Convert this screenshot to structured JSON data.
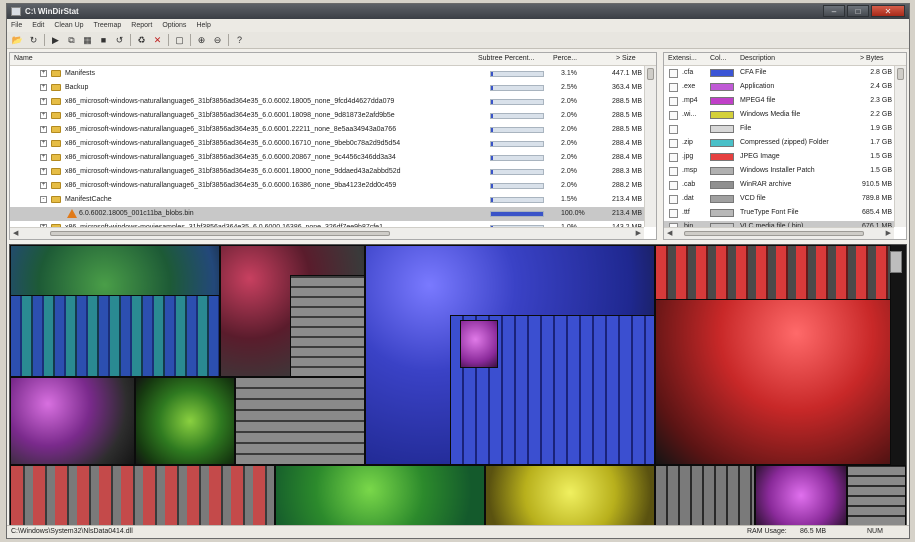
{
  "window": {
    "title": "C:\\ WinDirStat"
  },
  "menu": [
    "File",
    "Edit",
    "Clean Up",
    "Treemap",
    "Report",
    "Options",
    "Help"
  ],
  "toolbar_icons": [
    "open-icon",
    "refresh-icon",
    "play-icon",
    "copy-path-icon",
    "explorer-icon",
    "command-prompt-icon",
    "refresh-selected-icon",
    "recycle-icon",
    "delete-icon",
    "properties-icon",
    "zoom-in-icon",
    "zoom-out-icon",
    "help-icon"
  ],
  "tree": {
    "columns": {
      "name": "Name",
      "subtree": "Subtree Percent...",
      "percent": "Perce...",
      "size": "> Size"
    },
    "rows": [
      {
        "indent": 1,
        "type": "folder",
        "expand": "+",
        "name": "Manifests",
        "fill": 0.031,
        "percent": "3.1%",
        "size": "447.1 MB"
      },
      {
        "indent": 1,
        "type": "folder",
        "expand": "+",
        "name": "Backup",
        "fill": 0.025,
        "percent": "2.5%",
        "size": "363.4 MB"
      },
      {
        "indent": 1,
        "type": "folder",
        "expand": "+",
        "name": "x86_microsoft-windows-naturallanguage6_31bf3856ad364e35_6.0.6002.18005_none_9fcd4d4627dda079",
        "fill": 0.02,
        "percent": "2.0%",
        "size": "288.5 MB"
      },
      {
        "indent": 1,
        "type": "folder",
        "expand": "+",
        "name": "x86_microsoft-windows-naturallanguage6_31bf3856ad364e35_6.0.6001.18098_none_9d81873e2afd9b5e",
        "fill": 0.02,
        "percent": "2.0%",
        "size": "288.5 MB"
      },
      {
        "indent": 1,
        "type": "folder",
        "expand": "+",
        "name": "x86_microsoft-windows-naturallanguage6_31bf3856ad364e35_6.0.6001.22211_none_8e5aa34943a0a766",
        "fill": 0.02,
        "percent": "2.0%",
        "size": "288.5 MB"
      },
      {
        "indent": 1,
        "type": "folder",
        "expand": "+",
        "name": "x86_microsoft-windows-naturallanguage6_31bf3856ad364e35_6.0.6000.16710_none_9beb0c78a2d9d5d54",
        "fill": 0.02,
        "percent": "2.0%",
        "size": "288.4 MB"
      },
      {
        "indent": 1,
        "type": "folder",
        "expand": "+",
        "name": "x86_microsoft-windows-naturallanguage6_31bf3856ad364e35_6.0.6000.20867_none_9c4456c346dd3a34",
        "fill": 0.02,
        "percent": "2.0%",
        "size": "288.4 MB"
      },
      {
        "indent": 1,
        "type": "folder",
        "expand": "+",
        "name": "x86_microsoft-windows-naturallanguage6_31bf3856ad364e35_6.0.6001.18000_none_9ddaed43a2abbd52d",
        "fill": 0.02,
        "percent": "2.0%",
        "size": "288.3 MB"
      },
      {
        "indent": 1,
        "type": "folder",
        "expand": "+",
        "name": "x86_microsoft-windows-naturallanguage6_31bf3856ad364e35_6.0.6000.16386_none_9ba4123e2dd0c459",
        "fill": 0.02,
        "percent": "2.0%",
        "size": "288.2 MB"
      },
      {
        "indent": 1,
        "type": "folder",
        "expand": "-",
        "name": "ManifestCache",
        "fill": 0.015,
        "percent": "1.5%",
        "size": "213.4 MB"
      },
      {
        "indent": 2,
        "type": "file",
        "expand": "",
        "name": "6.0.6002.18005_001c11ba_blobs.bin",
        "fill": 1.0,
        "percent": "100.0%",
        "size": "213.4 MB",
        "selected": true
      },
      {
        "indent": 1,
        "type": "folder",
        "expand": "+",
        "name": "x86_microsoft-windows-moviesamples_31bf3856ad364e35_6.0.6000.16386_none_326df7ee9b87cfe1",
        "fill": 0.01,
        "percent": "1.0%",
        "size": "143.2 MB"
      }
    ]
  },
  "extensions": {
    "columns": {
      "ext": "Extensi...",
      "color": "Col...",
      "desc": "Description",
      "bytes": "> Bytes"
    },
    "rows": [
      {
        "ext": ".cfa",
        "color": "#3b55d6",
        "desc": "CFA File",
        "bytes": "2.8 GB"
      },
      {
        "ext": ".exe",
        "color": "#c05ad6",
        "desc": "Application",
        "bytes": "2.4 GB"
      },
      {
        "ext": ".mp4",
        "color": "#c040c8",
        "desc": "MPEG4 file",
        "bytes": "2.3 GB"
      },
      {
        "ext": ".wi...",
        "color": "#d4d03a",
        "desc": "Windows Media file",
        "bytes": "2.2 GB"
      },
      {
        "ext": "",
        "color": "#d8d8d8",
        "desc": "File",
        "bytes": "1.9 GB"
      },
      {
        "ext": ".zip",
        "color": "#4ac0c8",
        "desc": "Compressed (zipped) Folder",
        "bytes": "1.7 GB"
      },
      {
        "ext": ".jpg",
        "color": "#e64040",
        "desc": "JPEG Image",
        "bytes": "1.5 GB"
      },
      {
        "ext": ".msp",
        "color": "#b0b0b0",
        "desc": "Windows Installer Patch",
        "bytes": "1.5 GB"
      },
      {
        "ext": ".cab",
        "color": "#909090",
        "desc": "WinRAR archive",
        "bytes": "910.5 MB"
      },
      {
        "ext": ".dat",
        "color": "#a0a0a0",
        "desc": "VCD file",
        "bytes": "789.8 MB"
      },
      {
        "ext": ".ttf",
        "color": "#b8b8b8",
        "desc": "TrueType Font File",
        "bytes": "685.4 MB"
      },
      {
        "ext": ".bin",
        "color": "#c8c8c8",
        "desc": "VLC media file (.bin)",
        "bytes": "676.1 MB",
        "selected": true
      }
    ]
  },
  "statusbar": {
    "path": "C:\\Windows\\System32\\NlsData0414.dll",
    "ram_label": "RAM Usage:",
    "ram_value": "86.5 MB",
    "num": "NUM"
  }
}
